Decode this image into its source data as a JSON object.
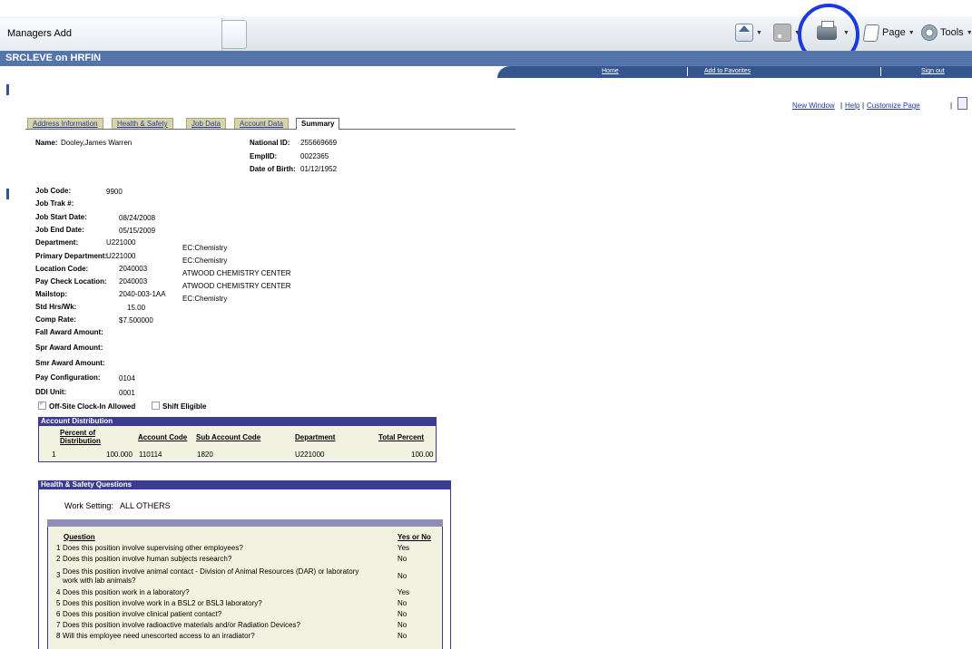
{
  "browser": {
    "tab_title": "Managers Add",
    "toolbar": {
      "page_label": "Page",
      "tools_label": "Tools"
    }
  },
  "header": {
    "title": "SRCLEVE on HRFIN",
    "nav": [
      "Home",
      "Add to Favorites",
      "Sign out"
    ]
  },
  "page_links": [
    "New Window",
    "Help",
    "Customize Page"
  ],
  "tabs": [
    "Address Information",
    "Health & Safety",
    "Job Data",
    "Account Data",
    "Summary"
  ],
  "employee": {
    "name_label": "Name:",
    "name": "Dooley,James Warren",
    "national_id_label": "National ID:",
    "national_id": "255669669",
    "emplid_label": "EmplID:",
    "emplid": "0022365",
    "dob_label": "Date of Birth:",
    "dob": "01/12/1952"
  },
  "job_fields": [
    {
      "label": "Job Code:",
      "value": "9900",
      "desc": ""
    },
    {
      "label": "Job Trak #:",
      "value": "",
      "desc": ""
    },
    {
      "label": "Job Start Date:",
      "value": "08/24/2008",
      "desc": ""
    },
    {
      "label": "Job End Date:",
      "value": "05/15/2009",
      "desc": ""
    },
    {
      "label": "Department:",
      "value": "U221000",
      "desc": "EC:Chemistry"
    },
    {
      "label": "Primary Department:",
      "value": "U221000",
      "desc": "EC:Chemistry"
    },
    {
      "label": "Location Code:",
      "value": "2040003",
      "desc": "ATWOOD CHEMISTRY CENTER"
    },
    {
      "label": "Pay Check Location:",
      "value": "2040003",
      "desc": "ATWOOD CHEMISTRY CENTER"
    },
    {
      "label": "Mailstop:",
      "value": "2040-003-1AA",
      "desc": "EC:Chemistry"
    },
    {
      "label": "Std Hrs/Wk:",
      "value": "15.00",
      "desc": ""
    },
    {
      "label": "Comp Rate:",
      "value": "$7.500000",
      "desc": ""
    },
    {
      "label": "Fall Award Amount:",
      "value": "",
      "desc": ""
    },
    {
      "label": "Spr Award Amount:",
      "value": "",
      "desc": ""
    },
    {
      "label": "Smr Award Amount:",
      "value": "",
      "desc": ""
    },
    {
      "label": "Pay Configuration:",
      "value": "0104",
      "desc": ""
    },
    {
      "label": "DDI Unit:",
      "value": "0001",
      "desc": ""
    }
  ],
  "checkboxes": [
    {
      "label": "Off-Site Clock-In Allowed",
      "checked": true
    },
    {
      "label": "Shift Eligible",
      "checked": false
    }
  ],
  "account_distribution": {
    "title": "Account Distribution",
    "headers": [
      "Percent of Distribution",
      "Account Code",
      "Sub Account Code",
      "Department",
      "Total Percent"
    ],
    "header_line1": "Percent of",
    "header_line2": "Distribution",
    "rows": [
      {
        "row": "1",
        "percent": "100.000",
        "account": "110114",
        "sub_account": "1820",
        "department": "U221000",
        "total": "100.00"
      }
    ]
  },
  "health_safety": {
    "title": "Health & Safety Questions",
    "work_setting_label": "Work Setting:",
    "work_setting": "ALL OTHERS",
    "headers": [
      "Question",
      "Yes or No"
    ],
    "rows": [
      {
        "n": "1",
        "q": "Does this position involve supervising other employees?",
        "a": "Yes"
      },
      {
        "n": "2",
        "q": "Does this position involve human subjects research?",
        "a": "No"
      },
      {
        "n": "3",
        "q": "Does this position involve animal contact - Division of Animal Resources (DAR) or laboratory",
        "q2": "work with lab animals?",
        "a": "No"
      },
      {
        "n": "4",
        "q": "Does this position work in a laboratory?",
        "a": "Yes"
      },
      {
        "n": "5",
        "q": "Does this position involve work in a BSL2 or BSL3 laboratory?",
        "a": "No"
      },
      {
        "n": "6",
        "q": "Does this position involve clinical patient contact?",
        "a": "No"
      },
      {
        "n": "7",
        "q": "Does this position involve radioactive materials and/or Radiation Devices?",
        "a": "No"
      },
      {
        "n": "8",
        "q": "Will this employee need unescorted access to an irradiator?",
        "a": "No"
      }
    ]
  },
  "colors": {
    "header_blue": "#4a6aa0",
    "grid_header": "#3b3b8f",
    "annotation_circle": "#1a3ae0"
  }
}
